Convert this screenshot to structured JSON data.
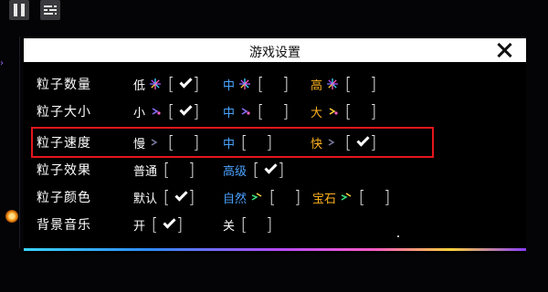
{
  "hud": {
    "pause_icon": "pause-icon",
    "menu_icon": "sliders-icon"
  },
  "dialog": {
    "title": "游戏设置",
    "close_icon": "close-icon",
    "accent_gradient": [
      "#3bd6ff",
      "#2f8cff",
      "#b44cff",
      "#ff5cc4",
      "#ffd23a",
      "#8a3dff"
    ],
    "highlight_color": "#e3161c"
  },
  "colors": {
    "white": "#ffffff",
    "blue": "#4aa3ff",
    "gold": "#ffb21e",
    "background": "#000000"
  },
  "settings": [
    {
      "label": "粒子数量",
      "options": [
        {
          "label": "低",
          "color": "white",
          "checked": true,
          "icon": "particle-burst-icon"
        },
        {
          "label": "中",
          "color": "blue",
          "checked": false,
          "icon": "particle-burst-icon"
        },
        {
          "label": "高",
          "color": "gold",
          "checked": false,
          "icon": "particle-burst-icon"
        }
      ]
    },
    {
      "label": "粒子大小",
      "options": [
        {
          "label": "小",
          "color": "white",
          "checked": true,
          "icon": "particle-size-icon"
        },
        {
          "label": "中",
          "color": "blue",
          "checked": false,
          "icon": "particle-size-icon"
        },
        {
          "label": "大",
          "color": "gold",
          "checked": false,
          "icon": "particle-size-icon"
        }
      ]
    },
    {
      "label": "粒子速度",
      "options": [
        {
          "label": "慢",
          "color": "white",
          "checked": false,
          "icon": "particle-speed-icon"
        },
        {
          "label": "中",
          "color": "blue",
          "checked": false,
          "icon": ""
        },
        {
          "label": "快",
          "color": "gold",
          "checked": true,
          "icon": "particle-speed-icon"
        }
      ]
    },
    {
      "label": "粒子效果",
      "options": [
        {
          "label": "普通",
          "color": "white",
          "checked": false,
          "icon": ""
        },
        {
          "label": "高级",
          "color": "blue",
          "checked": true,
          "icon": ""
        }
      ]
    },
    {
      "label": "粒子颜色",
      "options": [
        {
          "label": "默认",
          "color": "white",
          "checked": true,
          "icon": ""
        },
        {
          "label": "自然",
          "color": "blue",
          "checked": false,
          "icon": "particle-color-icon"
        },
        {
          "label": "宝石",
          "color": "gold",
          "checked": false,
          "icon": "particle-color-icon"
        }
      ]
    },
    {
      "label": "背景音乐",
      "options": [
        {
          "label": "开",
          "color": "white",
          "checked": true,
          "icon": ""
        },
        {
          "label": "关",
          "color": "white",
          "checked": false,
          "icon": ""
        }
      ]
    }
  ],
  "highlighted_row": "粒子速度"
}
